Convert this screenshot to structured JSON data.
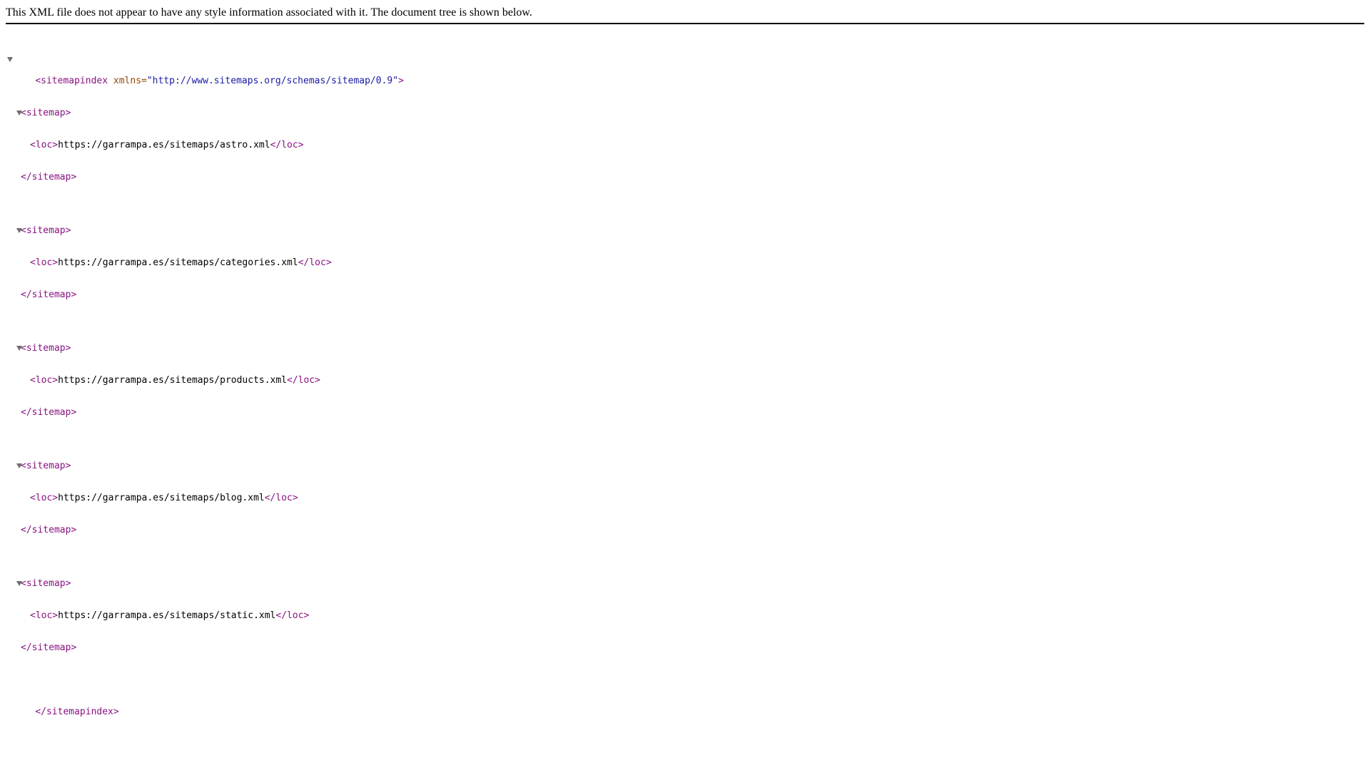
{
  "header": {
    "message": "This XML file does not appear to have any style information associated with it. The document tree is shown below."
  },
  "root": {
    "open_tag": "<sitemapindex",
    "attr_name": " xmlns=",
    "attr_value": "\"http://www.sitemaps.org/schemas/sitemap/0.9\"",
    "open_end": ">",
    "close_tag": "</sitemapindex>"
  },
  "sitemap_tags": {
    "open": "<sitemap>",
    "close": "</sitemap>",
    "loc_open": "<loc>",
    "loc_close": "</loc>"
  },
  "sitemaps": [
    {
      "loc": "https://garrampa.es/sitemaps/astro.xml"
    },
    {
      "loc": "https://garrampa.es/sitemaps/categories.xml"
    },
    {
      "loc": "https://garrampa.es/sitemaps/products.xml"
    },
    {
      "loc": "https://garrampa.es/sitemaps/blog.xml"
    },
    {
      "loc": "https://garrampa.es/sitemaps/static.xml"
    }
  ]
}
